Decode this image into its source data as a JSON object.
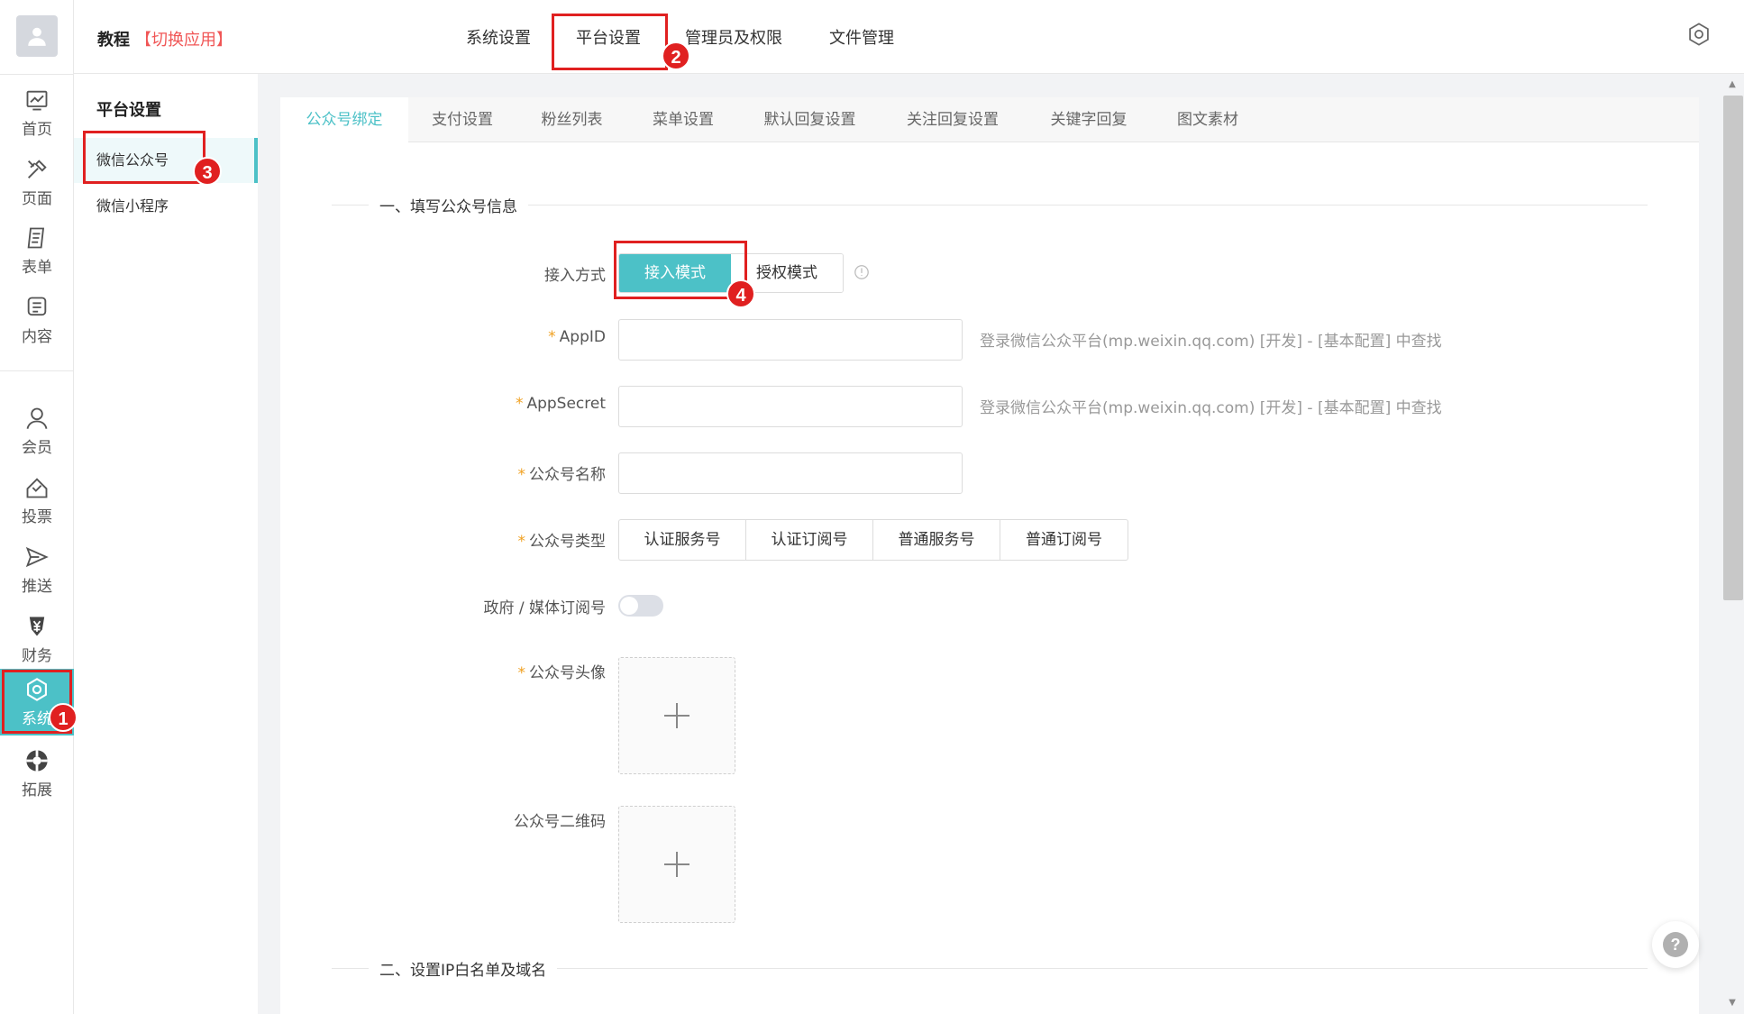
{
  "colors": {
    "accent": "#4cc1c7",
    "annotation": "#e02020",
    "switch_app": "#f05656"
  },
  "header": {
    "app_name": "教程",
    "switch_app": "【切换应用】",
    "nav": [
      "系统设置",
      "平台设置",
      "管理员及权限",
      "文件管理"
    ],
    "settings_icon": "gear-icon"
  },
  "rail": {
    "avatar_icon": "user-icon",
    "items": [
      {
        "label": "首页",
        "icon": "chart-icon"
      },
      {
        "label": "页面",
        "icon": "tools-icon"
      },
      {
        "label": "表单",
        "icon": "form-icon"
      },
      {
        "label": "内容",
        "icon": "content-icon"
      },
      {
        "label": "会员",
        "icon": "member-icon"
      },
      {
        "label": "投票",
        "icon": "vote-icon"
      },
      {
        "label": "推送",
        "icon": "send-icon"
      },
      {
        "label": "财务",
        "icon": "finance-icon"
      },
      {
        "label": "系统",
        "icon": "system-icon"
      },
      {
        "label": "拓展",
        "icon": "extend-icon"
      }
    ]
  },
  "subside": {
    "title": "平台设置",
    "items": [
      "微信公众号",
      "微信小程序"
    ]
  },
  "tabs": [
    "公众号绑定",
    "支付设置",
    "粉丝列表",
    "菜单设置",
    "默认回复设置",
    "关注回复设置",
    "关键字回复",
    "图文素材"
  ],
  "form": {
    "section1": "一、填写公众号信息",
    "section2": "二、设置IP白名单及域名",
    "access_label": "接入方式",
    "access_modes": [
      "接入模式",
      "授权模式"
    ],
    "appid_label": "AppID",
    "appid_value": "",
    "appid_hint": "登录微信公众平台(mp.weixin.qq.com) [开发] - [基本配置] 中查找",
    "appsecret_label": "AppSecret",
    "appsecret_value": "",
    "appsecret_hint": "登录微信公众平台(mp.weixin.qq.com) [开发] - [基本配置] 中查找",
    "name_label": "公众号名称",
    "name_value": "",
    "type_label": "公众号类型",
    "types": [
      "认证服务号",
      "认证订阅号",
      "普通服务号",
      "普通订阅号"
    ],
    "gov_label": "政府 / 媒体订阅号",
    "avatar_label": "公众号头像",
    "qrcode_label": "公众号二维码",
    "required_mark": "*"
  },
  "annotations": [
    "1",
    "2",
    "3",
    "4"
  ],
  "help_icon": "help-icon"
}
